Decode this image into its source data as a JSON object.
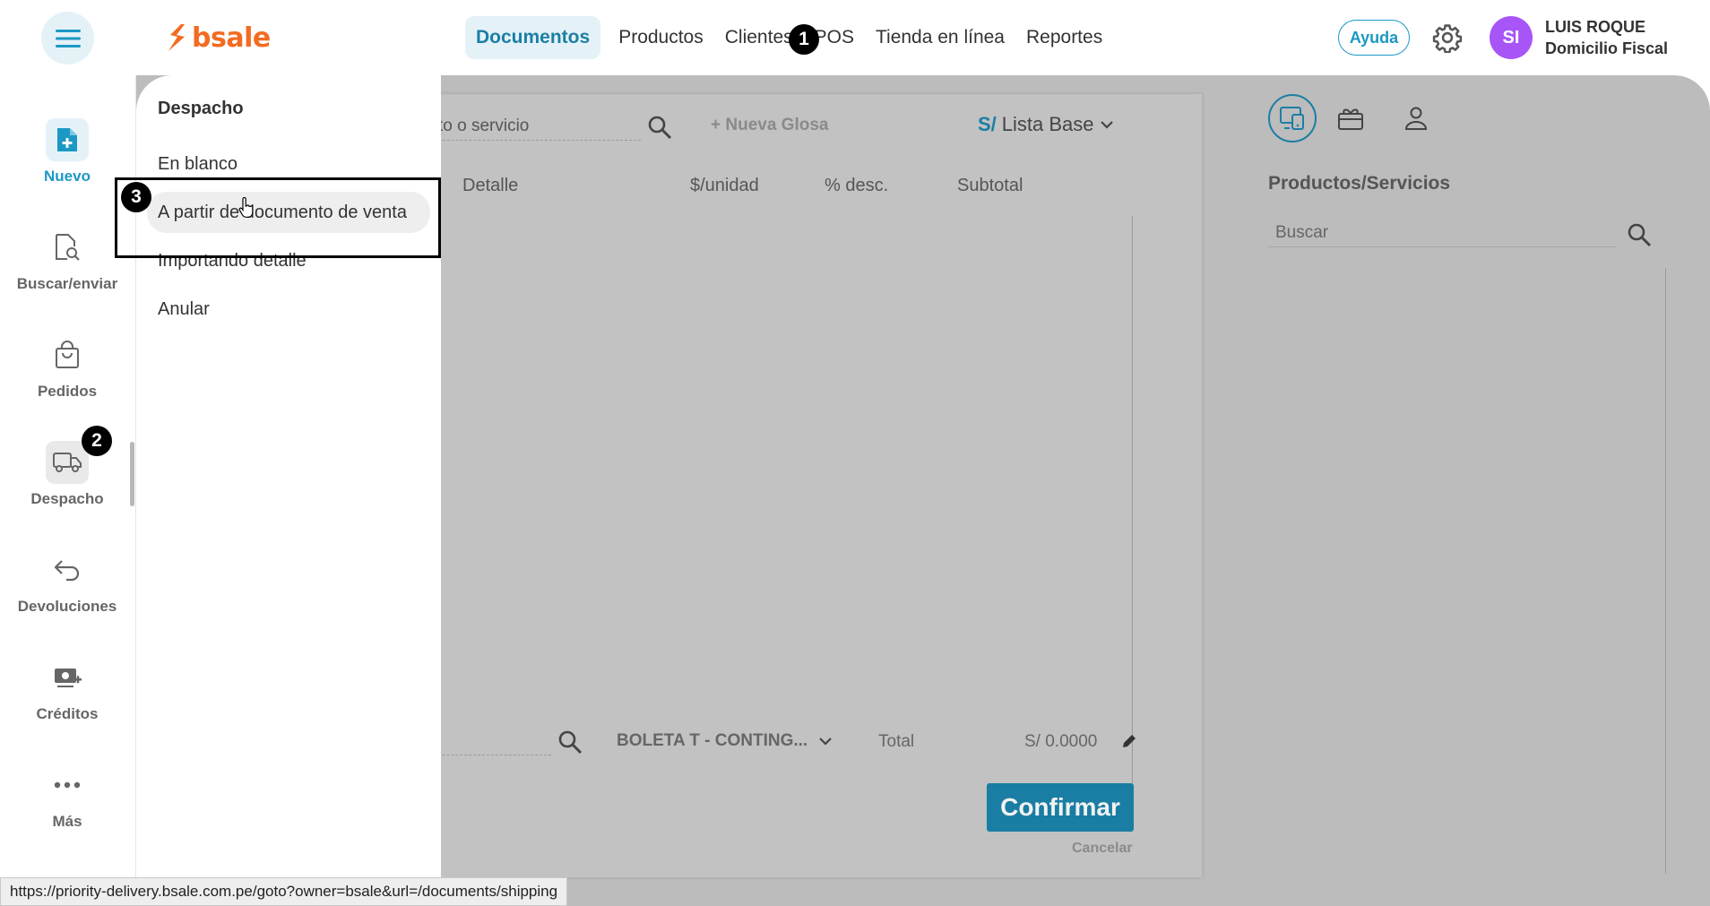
{
  "header": {
    "logo_text": "bsale",
    "nav": [
      {
        "label": "Documentos",
        "active": true
      },
      {
        "label": "Productos"
      },
      {
        "label": "Clientes"
      },
      {
        "label": "POS"
      },
      {
        "label": "Tienda en línea"
      },
      {
        "label": "Reportes"
      }
    ],
    "help_label": "Ayuda",
    "avatar_initials": "SI",
    "user_name": "LUIS ROQUE",
    "user_subtitle": "Domicilio Fiscal"
  },
  "sidebar": {
    "items": [
      {
        "label": "Nuevo",
        "icon": "new-document-icon"
      },
      {
        "label": "Buscar/enviar",
        "icon": "search-document-icon"
      },
      {
        "label": "Pedidos",
        "icon": "shopping-bag-icon"
      },
      {
        "label": "Despacho",
        "icon": "truck-icon"
      },
      {
        "label": "Devoluciones",
        "icon": "return-arrow-icon"
      },
      {
        "label": "Créditos",
        "icon": "credit-icon"
      },
      {
        "label": "Más",
        "icon": "more-dots-icon"
      }
    ]
  },
  "dropdown": {
    "title": "Despacho",
    "items": [
      {
        "label": "En blanco"
      },
      {
        "label": "A partir de documento de venta",
        "hovered": true
      },
      {
        "label": "Importando detalle"
      },
      {
        "label": "Anular"
      }
    ]
  },
  "document": {
    "search_placeholder_fragment": "to o servicio",
    "new_gloss_label": "+ Nueva Glosa",
    "currency_symbol": "S/",
    "price_list_label": "Lista Base",
    "columns": [
      "Detalle",
      "$/unidad",
      "% desc.",
      "Subtotal"
    ],
    "doc_type_label": "BOLETA T - CONTING...",
    "total_label": "Total",
    "total_value": "S/ 0.0000",
    "confirm_label": "Confirmar",
    "cancel_label": "Cancelar"
  },
  "right_panel": {
    "title": "Productos/Servicios",
    "search_placeholder": "Buscar"
  },
  "annotations": {
    "badge_1": "1",
    "badge_2": "2",
    "badge_3": "3"
  },
  "status_bar": {
    "url": "https://priority-delivery.bsale.com.pe/goto?owner=bsale&url=/documents/shipping"
  },
  "colors": {
    "brand_orange": "#f36b21",
    "accent_blue": "#1c98c4",
    "avatar_purple": "#a855f7",
    "confirm_button": "#1a7da4"
  }
}
